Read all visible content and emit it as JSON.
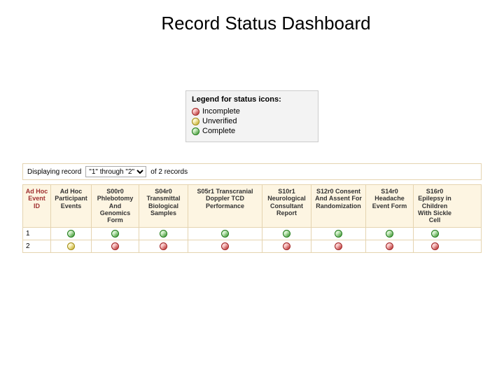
{
  "title": "Record Status Dashboard",
  "legend": {
    "title": "Legend for status icons:",
    "items": [
      {
        "color": "red",
        "label": "Incomplete"
      },
      {
        "color": "yellow",
        "label": "Unverified"
      },
      {
        "color": "green",
        "label": "Complete"
      }
    ]
  },
  "display_bar": {
    "prefix": "Displaying record",
    "selected": "\"1\" through \"2\"",
    "suffix": "of 2 records"
  },
  "columns": [
    "Ad Hoc Event ID",
    "Ad Hoc Participant Events",
    "S00r0 Phlebotomy And Genomics Form",
    "S04r0 Transmittal Biological Samples",
    "S05r1 Transcranial Doppler TCD Performance",
    "S10r1 Neurological Consultant Report",
    "S12r0 Consent And Assent For Randomization",
    "S14r0 Headache Event Form",
    "S16r0 Epilepsy in Children With Sickle Cell"
  ],
  "rows": [
    {
      "id": "1",
      "cells": [
        "green",
        "green",
        "green",
        "green",
        "green",
        "green",
        "green",
        "green"
      ]
    },
    {
      "id": "2",
      "cells": [
        "yellow",
        "red",
        "red",
        "red",
        "red",
        "red",
        "red",
        "red"
      ]
    }
  ]
}
